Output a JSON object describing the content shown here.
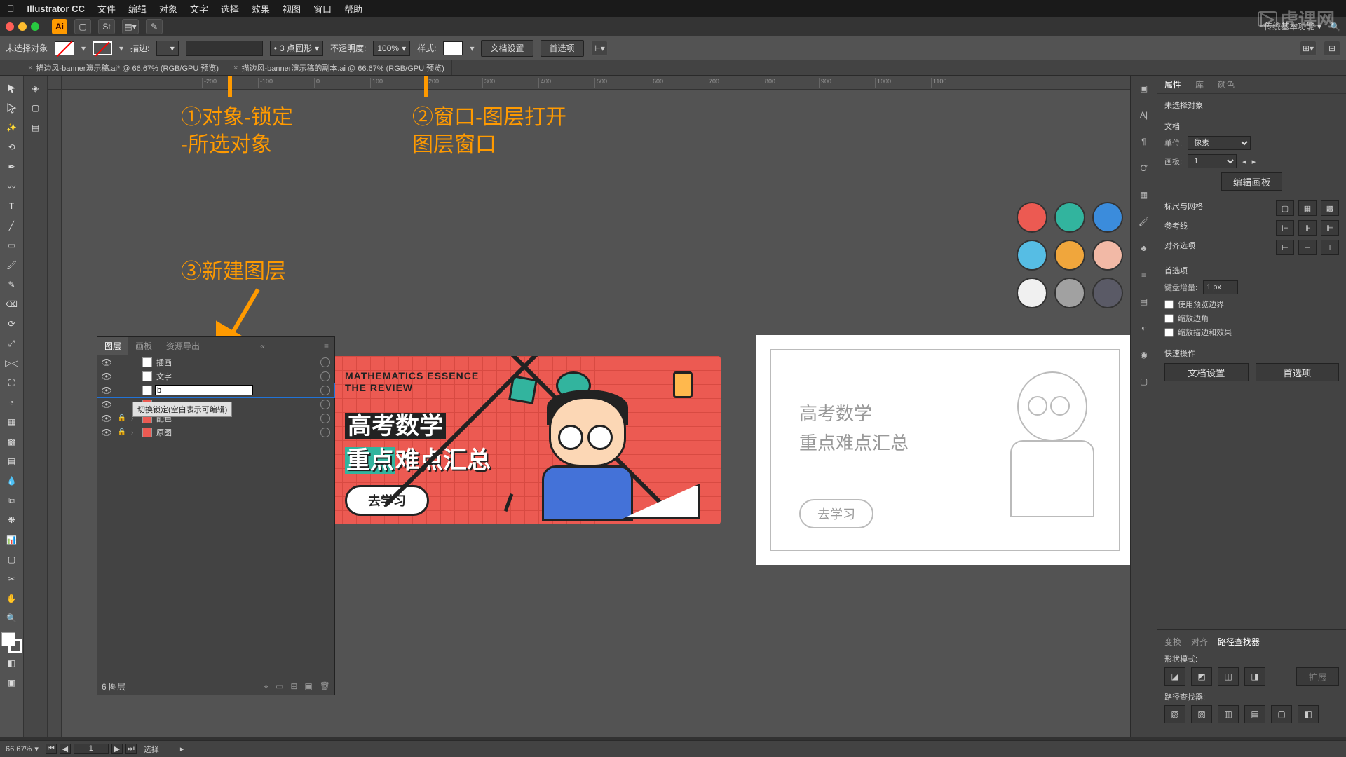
{
  "menubar": {
    "app_name": "Illustrator CC",
    "items": [
      "文件",
      "编辑",
      "对象",
      "文字",
      "选择",
      "效果",
      "视图",
      "窗口",
      "帮助"
    ]
  },
  "workspace_label": "传统基本功能",
  "controlbar": {
    "no_selection": "未选择对象",
    "stroke_label": "描边:",
    "stroke_weight": "",
    "stroke_profile": "3 点圆形",
    "opacity_label": "不透明度:",
    "opacity_value": "100%",
    "style_label": "样式:",
    "doc_setup": "文档设置",
    "prefs": "首选项"
  },
  "tabs": [
    "描边风-banner演示稿.ai* @ 66.67% (RGB/GPU 预览)",
    "描边风-banner演示稿的副本.ai @ 66.67% (RGB/GPU 预览)"
  ],
  "ruler_marks": [
    "-200",
    "-100",
    "0",
    "100",
    "200",
    "300",
    "400",
    "500",
    "600",
    "700",
    "800",
    "900",
    "1000",
    "1100"
  ],
  "annotations": {
    "a1": "①对象-锁定\n-所选对象",
    "a2": "②窗口-图层打开\n图层窗口",
    "a3": "③新建图层"
  },
  "palette": [
    [
      "#ec5a52",
      "#32b49e",
      "#3b8cdc"
    ],
    [
      "#56bde4",
      "#f0a63c",
      "#f2b9a6"
    ],
    [
      "#f0f0f0",
      "#a1a1a1",
      "#5a5a66"
    ]
  ],
  "banner": {
    "en": "MATHEMATICS ESSENCE\nTHE REVIEW",
    "cn1": "高考数学",
    "cn2_a": "重点",
    "cn2_b": "难点汇总",
    "btn": "去学习"
  },
  "sketch": {
    "lines": [
      "高考数学",
      "重点难点汇总"
    ],
    "btn": "去学习"
  },
  "layers": {
    "tabs": [
      "图层",
      "画板",
      "资源导出"
    ],
    "tooltip": "切换锁定(空白表示可编辑)",
    "rows": [
      {
        "name": "插画",
        "locked": false,
        "expand": false,
        "editing": false
      },
      {
        "name": "文字",
        "locked": false,
        "expand": false,
        "editing": false
      },
      {
        "name": "b",
        "locked": false,
        "expand": false,
        "editing": true
      },
      {
        "name": "",
        "locked": false,
        "expand": false,
        "editing": false
      },
      {
        "name": "配色",
        "locked": true,
        "expand": true,
        "editing": false
      },
      {
        "name": "原图",
        "locked": true,
        "expand": true,
        "editing": false
      }
    ],
    "footer_count": "6 图层"
  },
  "props": {
    "tabs": [
      "属性",
      "库",
      "颜色"
    ],
    "no_selection": "未选择对象",
    "section_doc": "文档",
    "unit_label": "单位:",
    "unit_value": "像素",
    "artboard_label": "画板:",
    "artboard_value": "1",
    "edit_artboards": "编辑画板",
    "section_rulers": "标尺与网格",
    "section_guides": "参考线",
    "section_align": "对齐选项",
    "section_prefs": "首选项",
    "kb_inc_label": "键盘增量:",
    "kb_inc_value": "1 px",
    "chk_preview": "使用预览边界",
    "chk_scale_corner": "缩放边角",
    "chk_scale_stroke": "缩放描边和效果",
    "quick_actions": "快速操作",
    "btn_doc_setup": "文档设置",
    "btn_prefs": "首选项",
    "bottom_tabs": [
      "变换",
      "对齐",
      "路径查找器"
    ],
    "shape_mode": "形状模式:",
    "pathfinders": "路径查找器:",
    "expand": "扩展"
  },
  "status": {
    "zoom": "66.67%",
    "tool": "选择"
  },
  "watermark": "虎课网"
}
